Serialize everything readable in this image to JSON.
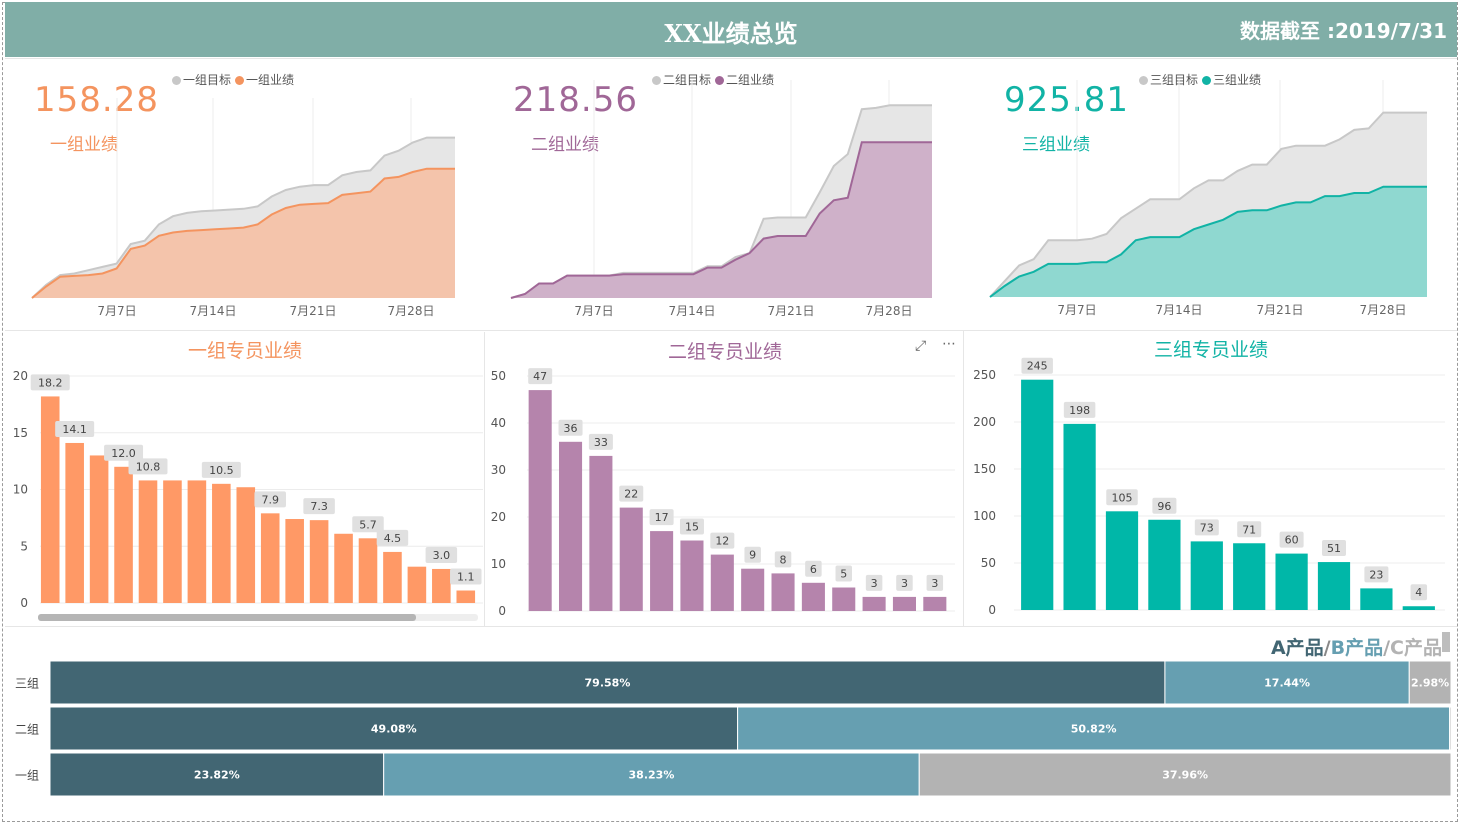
{
  "header": {
    "title": "XX业绩总览",
    "date": "数据截至 :2019/7/31"
  },
  "groups": [
    {
      "kpi": "158.28",
      "label": "一组业绩",
      "color": "#f4945f",
      "fill": "#f4c4ab",
      "legend_target": "一组目标",
      "legend_actual": "一组业绩",
      "bar_title": "一组专员业绩"
    },
    {
      "kpi": "218.56",
      "label": "二组业绩",
      "color": "#a06797",
      "fill": "#cfb1c9",
      "legend_target": "二组目标",
      "legend_actual": "二组业绩",
      "bar_title": "二组专员业绩"
    },
    {
      "kpi": "925.81",
      "label": "三组业绩",
      "color": "#11b3a5",
      "fill": "#8fd8d0",
      "legend_target": "三组目标",
      "legend_actual": "三组业绩",
      "bar_title": "三组专员业绩"
    }
  ],
  "product_legend": {
    "a": "A产品",
    "b": "B产品",
    "c": "C产品",
    "sep": "/"
  },
  "toolbar": {
    "focus_icon": "⤢",
    "more_icon": "⋯"
  },
  "chart_data": [
    {
      "type": "area",
      "name": "group1-trend",
      "x_ticks": [
        "7月7日",
        "7月14日",
        "7月21日",
        "7月28日"
      ],
      "x": [
        1,
        2,
        3,
        4,
        5,
        6,
        7,
        8,
        9,
        10,
        11,
        12,
        13,
        14,
        15,
        16,
        17,
        18,
        19,
        20,
        21,
        22,
        23,
        24,
        25,
        26,
        27,
        28,
        29,
        30,
        31
      ],
      "series": [
        {
          "name": "一组目标",
          "values": [
            0,
            8,
            14,
            15,
            17,
            19,
            21,
            33,
            35,
            45,
            50,
            52,
            53,
            53.5,
            54,
            54.5,
            56,
            62,
            66,
            68,
            69,
            69,
            75,
            77,
            78,
            87,
            90,
            95,
            98,
            98,
            98
          ]
        },
        {
          "name": "一组业绩",
          "values": [
            0,
            7,
            13,
            13.5,
            14,
            15,
            18,
            30,
            32,
            38,
            40,
            41,
            41.5,
            42,
            42.5,
            43,
            45,
            51,
            55,
            57,
            57.5,
            58,
            63,
            64,
            65,
            73,
            74,
            77,
            79,
            79,
            79
          ]
        }
      ]
    },
    {
      "type": "area",
      "name": "group2-trend",
      "x_ticks": [
        "7月7日",
        "7月14日",
        "7月21日",
        "7月28日"
      ],
      "x": [
        1,
        2,
        3,
        4,
        5,
        6,
        7,
        8,
        9,
        10,
        11,
        12,
        13,
        14,
        15,
        16,
        17,
        18,
        19,
        20,
        21,
        22,
        23,
        24,
        25,
        26,
        27,
        28,
        29,
        30,
        31
      ],
      "series": [
        {
          "name": "二组目标",
          "values": [
            0,
            3,
            11,
            11,
            17,
            17,
            17,
            17,
            19,
            19,
            19,
            19,
            19,
            19,
            24,
            24,
            31,
            34,
            60,
            61,
            61,
            61,
            80,
            100,
            109,
            143,
            144,
            146,
            146,
            146,
            146
          ]
        },
        {
          "name": "二组业绩",
          "values": [
            0,
            3,
            11,
            11,
            17,
            17,
            17,
            17,
            18,
            18,
            18,
            18,
            18,
            18,
            23,
            23,
            29,
            34,
            45,
            47,
            47,
            47,
            64,
            74,
            76,
            118,
            118,
            118,
            118,
            118,
            118
          ]
        }
      ]
    },
    {
      "type": "area",
      "name": "group3-trend",
      "x_ticks": [
        "7月7日",
        "7月14日",
        "7月21日",
        "7月28日"
      ],
      "x": [
        1,
        2,
        3,
        4,
        5,
        6,
        7,
        8,
        9,
        10,
        11,
        12,
        13,
        14,
        15,
        16,
        17,
        18,
        19,
        20,
        21,
        22,
        23,
        24,
        25,
        26,
        27,
        28,
        29,
        30,
        31
      ],
      "series": [
        {
          "name": "三组目标",
          "values": [
            0,
            10,
            20,
            24,
            36,
            36,
            36,
            37,
            40,
            50,
            56,
            62,
            62,
            62,
            69,
            74,
            74,
            80,
            84,
            84,
            94,
            96,
            96,
            96,
            100,
            106,
            107,
            117,
            117,
            117,
            117
          ]
        },
        {
          "name": "三组业绩",
          "values": [
            0,
            7,
            13,
            16,
            21,
            21,
            21,
            22,
            22,
            27,
            36,
            38,
            38,
            38,
            43,
            46,
            49,
            54,
            55,
            55,
            58,
            60,
            60,
            64,
            64,
            66,
            66,
            70,
            70,
            70,
            70
          ]
        }
      ]
    },
    {
      "type": "bar",
      "name": "group1-members",
      "ylim": [
        0,
        20
      ],
      "y_ticks": [
        0,
        5,
        10,
        15,
        20
      ],
      "values": [
        18.2,
        14.1,
        13.0,
        12.0,
        10.8,
        10.8,
        10.8,
        10.5,
        10.2,
        7.9,
        7.4,
        7.3,
        6.1,
        5.7,
        4.5,
        3.2,
        3.0,
        1.1
      ],
      "labels": [
        "18.2",
        "14.1",
        "",
        "12.0",
        "10.8",
        "",
        "",
        "10.5",
        "",
        "7.9",
        "",
        "7.3",
        "",
        "5.7",
        "4.5",
        "",
        "3.0",
        "1.1"
      ]
    },
    {
      "type": "bar",
      "name": "group2-members",
      "ylim": [
        0,
        50
      ],
      "y_ticks": [
        0,
        10,
        20,
        30,
        40,
        50
      ],
      "values": [
        47,
        36,
        33,
        22,
        17,
        15,
        12,
        9,
        8,
        6,
        5,
        3,
        3,
        3
      ],
      "labels": [
        "47",
        "36",
        "33",
        "22",
        "17",
        "15",
        "12",
        "9",
        "8",
        "6",
        "5",
        "3",
        "3",
        "3"
      ]
    },
    {
      "type": "bar",
      "name": "group3-members",
      "ylim": [
        0,
        250
      ],
      "y_ticks": [
        0,
        50,
        100,
        150,
        200,
        250
      ],
      "values": [
        245,
        198,
        105,
        96,
        73,
        71,
        60,
        51,
        23,
        4
      ],
      "labels": [
        "245",
        "198",
        "105",
        "96",
        "73",
        "71",
        "60",
        "51",
        "23",
        "4"
      ]
    },
    {
      "type": "bar",
      "name": "product-share",
      "stacked": true,
      "orientation": "horizontal",
      "categories": [
        "三组",
        "二组",
        "一组"
      ],
      "series": [
        {
          "name": "A产品",
          "color": "#426673",
          "values": [
            79.58,
            49.08,
            23.82
          ],
          "labels": [
            "79.58%",
            "49.08%",
            "23.82%"
          ]
        },
        {
          "name": "B产品",
          "color": "#669fb1",
          "values": [
            17.44,
            50.82,
            38.23
          ],
          "labels": [
            "17.44%",
            "50.82%",
            "38.23%"
          ]
        },
        {
          "name": "C产品",
          "color": "#b3b3b3",
          "values": [
            2.98,
            0.1,
            37.96
          ],
          "labels": [
            "2.98%",
            "",
            "37.96%"
          ]
        }
      ]
    }
  ]
}
